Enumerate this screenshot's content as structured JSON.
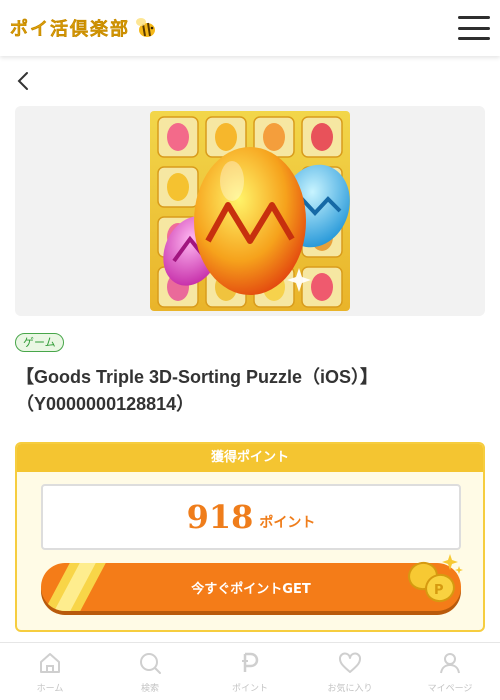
{
  "header": {
    "logo_text": "ポイ活倶楽部"
  },
  "offer": {
    "category": "ゲーム",
    "title": "【Goods Triple 3D-Sorting Puzzle（iOS）】（Y0000000128814）"
  },
  "points": {
    "header_label": "獲得ポイント",
    "value": "918",
    "unit": "ポイント",
    "button_label": "今すぐポイントGET"
  },
  "nav": {
    "items": [
      {
        "label": "ホーム",
        "icon": "home-icon"
      },
      {
        "label": "検索",
        "icon": "search-icon"
      },
      {
        "label": "ポイント",
        "icon": "point-icon"
      },
      {
        "label": "お気に入り",
        "icon": "heart-icon"
      },
      {
        "label": "マイページ",
        "icon": "person-icon"
      }
    ]
  },
  "colors": {
    "brand_yellow": "#f4c531",
    "accent_orange": "#f47c18",
    "category_green": "#2f9b36"
  }
}
